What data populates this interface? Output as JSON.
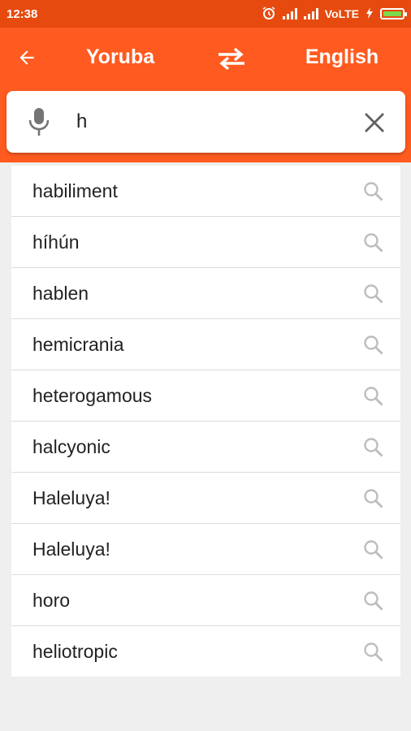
{
  "status_bar": {
    "time": "12:38",
    "network": "VoLTE"
  },
  "header": {
    "source_language": "Yoruba",
    "target_language": "English"
  },
  "search": {
    "query": "h"
  },
  "results": [
    "habiliment",
    "híhún",
    "hablen",
    "hemicrania",
    "heterogamous",
    "halcyonic",
    "Haleluya!",
    "Haleluya!",
    "horo",
    "heliotropic"
  ],
  "colors": {
    "accent": "#ff5a1f",
    "status_bar": "#e64a0f"
  }
}
